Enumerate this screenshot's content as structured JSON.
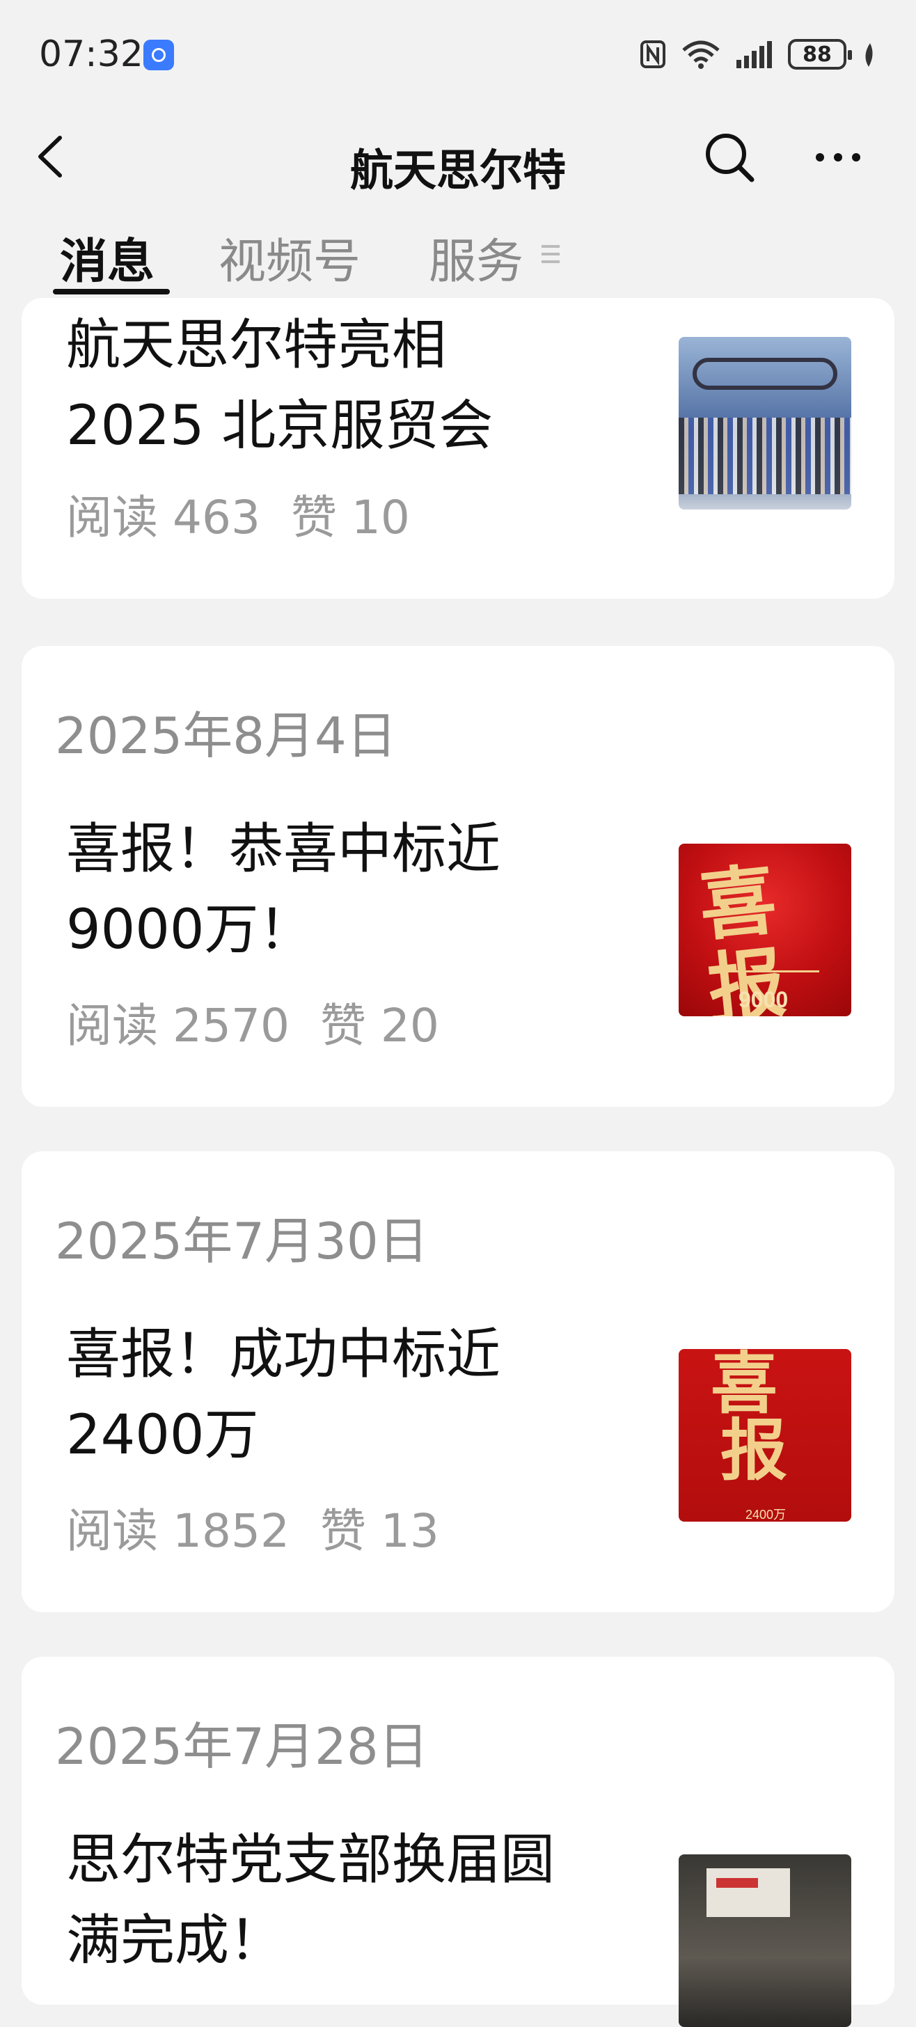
{
  "status_bar": {
    "time": "07:32",
    "battery": "88",
    "icons": [
      "nfc-icon",
      "wifi-icon",
      "signal-icon",
      "battery-icon",
      "leaf-icon"
    ]
  },
  "header": {
    "title": "航天思尔特",
    "icons": [
      "back-icon",
      "search-icon",
      "more-icon"
    ]
  },
  "tabs": [
    {
      "label": "消息",
      "active": true
    },
    {
      "label": "视频号",
      "active": false
    },
    {
      "label": "服务",
      "active": false
    }
  ],
  "feed": [
    {
      "date": "",
      "title_lines": [
        "航天思尔特亮相",
        "2025 北京服贸会"
      ],
      "reads_label": "阅读 463",
      "likes_label": "赞 10"
    },
    {
      "date": "2025年8月4日",
      "title_lines": [
        "喜报！恭喜中标近",
        "9000万！"
      ],
      "reads_label": "阅读 2570",
      "likes_label": "赞 20",
      "thumb_text": {
        "big": "喜报",
        "small": "9000"
      }
    },
    {
      "date": "2025年7月30日",
      "title_lines": [
        "喜报！成功中标近",
        "2400万"
      ],
      "reads_label": "阅读 1852",
      "likes_label": "赞 13",
      "thumb_text": {
        "big1": "喜",
        "big2": "报",
        "small": "2400万"
      }
    },
    {
      "date": "2025年7月28日",
      "title_lines": [
        "思尔特党支部换届圆",
        "满完成！"
      ]
    }
  ],
  "colors": {
    "page_bg": "#f2f2f2",
    "card_bg": "#ffffff",
    "text_primary": "#111111",
    "text_secondary": "#9a9a9a",
    "badge_blue": "#3a7bff",
    "poster_red": "#c10f12"
  }
}
